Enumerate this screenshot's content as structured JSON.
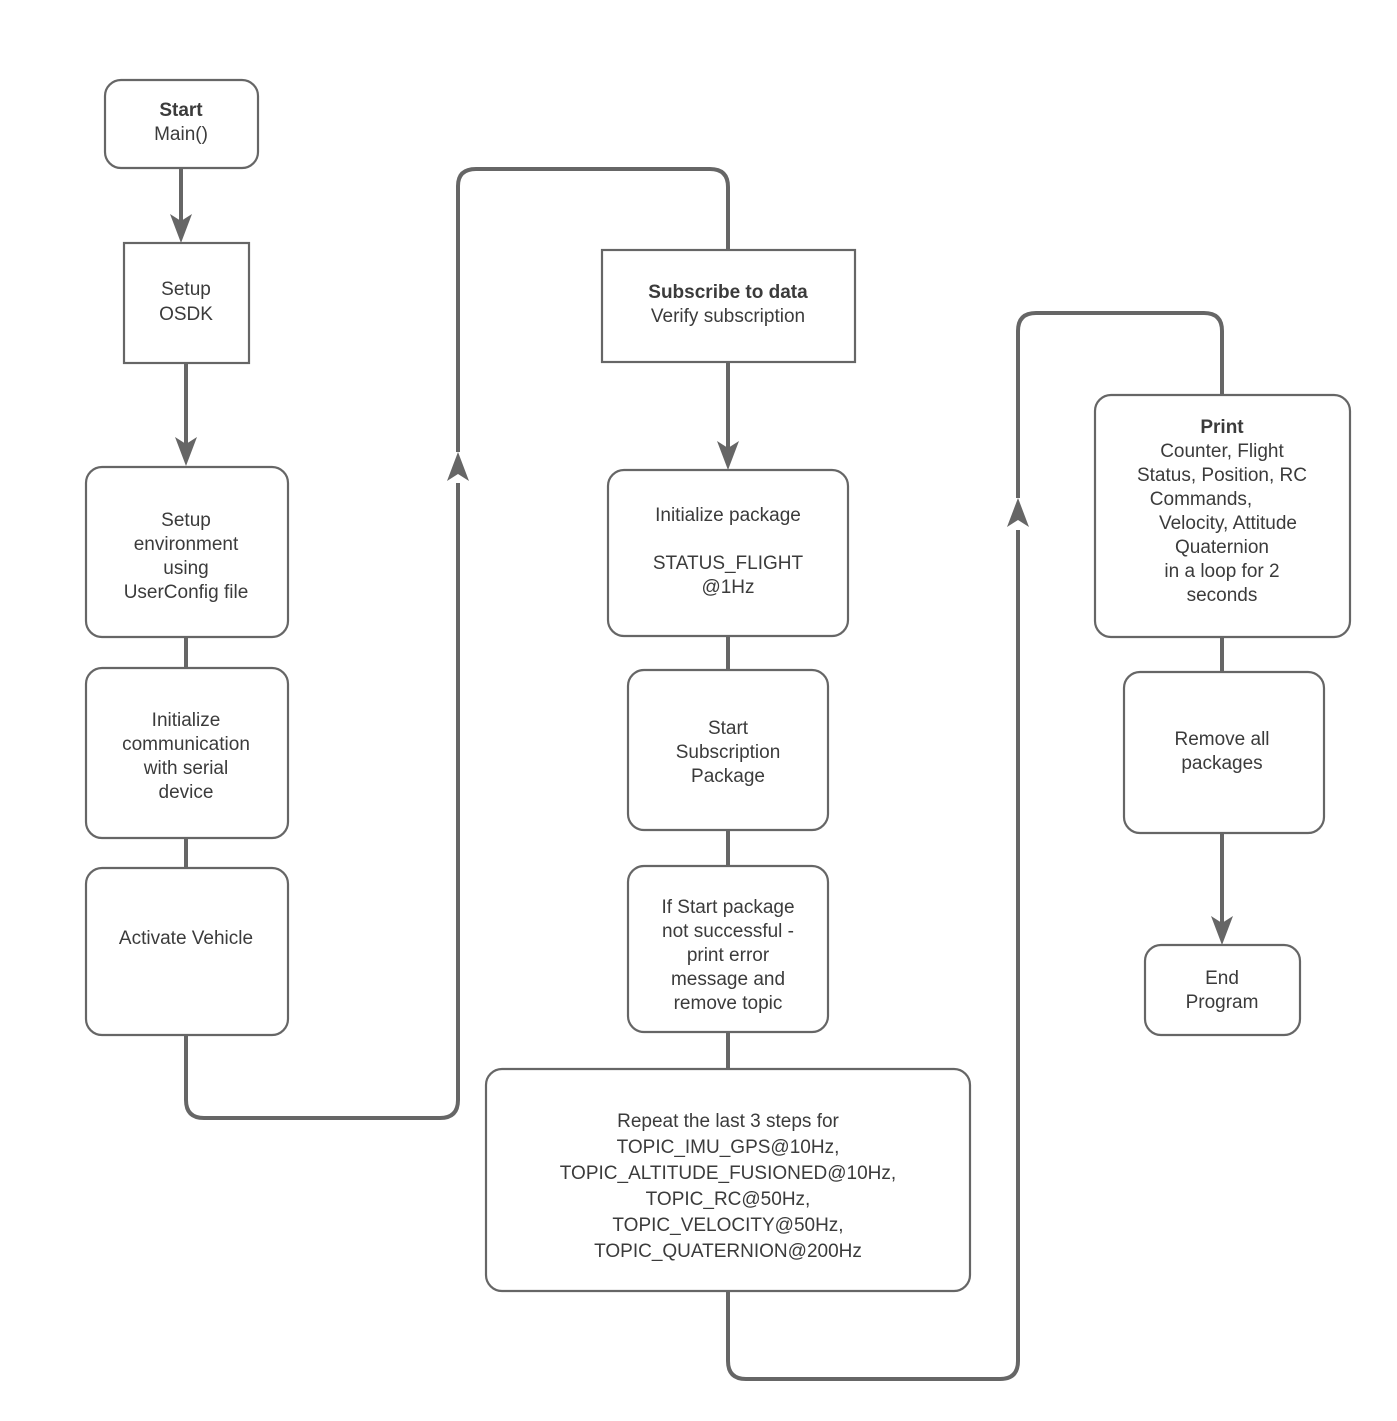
{
  "diagram": {
    "title": "OSDK Telemetry Subscription Program Flowchart",
    "colors": {
      "stroke": "#666666",
      "fill": "#ffffff",
      "text": "#3b3b3b"
    },
    "nodes": [
      {
        "id": "start",
        "shape": "rounded-rect",
        "lines": [
          {
            "text": "Start",
            "bold": true
          },
          {
            "text": "Main()",
            "bold": false
          }
        ]
      },
      {
        "id": "setup-osdk",
        "shape": "rect",
        "lines": [
          {
            "text": "Setup",
            "bold": false
          },
          {
            "text": "OSDK",
            "bold": false
          }
        ]
      },
      {
        "id": "setup-environment",
        "shape": "rounded-rect",
        "lines": [
          {
            "text": "Setup",
            "bold": false
          },
          {
            "text": "environment",
            "bold": false
          },
          {
            "text": "using",
            "bold": false
          },
          {
            "text": "UserConfig file",
            "bold": false
          }
        ]
      },
      {
        "id": "init-communication",
        "shape": "rounded-rect",
        "lines": [
          {
            "text": "Initialize",
            "bold": false
          },
          {
            "text": "communication",
            "bold": false
          },
          {
            "text": "with serial",
            "bold": false
          },
          {
            "text": "device",
            "bold": false
          }
        ]
      },
      {
        "id": "activate-vehicle",
        "shape": "rounded-rect",
        "lines": [
          {
            "text": "Activate Vehicle",
            "bold": false
          }
        ]
      },
      {
        "id": "subscribe-to-data",
        "shape": "rect",
        "lines": [
          {
            "text": "Subscribe to data",
            "bold": true
          },
          {
            "text": "Verify subscription",
            "bold": false
          }
        ]
      },
      {
        "id": "initialize-package",
        "shape": "rounded-rect",
        "lines": [
          {
            "text": "Initialize package",
            "bold": false
          },
          {
            "text": "",
            "bold": false
          },
          {
            "text": "STATUS_FLIGHT",
            "bold": false
          },
          {
            "text": "@1Hz",
            "bold": false
          }
        ]
      },
      {
        "id": "start-subscription-package",
        "shape": "rounded-rect",
        "lines": [
          {
            "text": "Start",
            "bold": false
          },
          {
            "text": "Subscription",
            "bold": false
          },
          {
            "text": "Package",
            "bold": false
          }
        ]
      },
      {
        "id": "start-package-error",
        "shape": "rounded-rect",
        "lines": [
          {
            "text": "If Start package",
            "bold": false
          },
          {
            "text": "not successful -",
            "bold": false
          },
          {
            "text": "print error",
            "bold": false
          },
          {
            "text": "message and",
            "bold": false
          },
          {
            "text": "remove topic",
            "bold": false
          }
        ]
      },
      {
        "id": "repeat-steps",
        "shape": "rounded-rect",
        "lines": [
          {
            "text": "Repeat the last 3 steps for",
            "bold": false
          },
          {
            "text": "TOPIC_IMU_GPS@10Hz,",
            "bold": false
          },
          {
            "text": "TOPIC_ALTITUDE_FUSIONED@10Hz,",
            "bold": false
          },
          {
            "text": "TOPIC_RC@50Hz,",
            "bold": false
          },
          {
            "text": "TOPIC_VELOCITY@50Hz,",
            "bold": false
          },
          {
            "text": "TOPIC_QUATERNION@200Hz",
            "bold": false
          }
        ]
      },
      {
        "id": "print",
        "shape": "rounded-rect",
        "lines": [
          {
            "text": "Print",
            "bold": true
          },
          {
            "text": "Counter, Flight",
            "bold": false
          },
          {
            "text": "Status, Position, RC",
            "bold": false
          },
          {
            "text": "Commands,",
            "bold": false
          },
          {
            "text": "Velocity, Attitude",
            "bold": false
          },
          {
            "text": "Quaternion",
            "bold": false
          },
          {
            "text": "in a loop for 2",
            "bold": false
          },
          {
            "text": "seconds",
            "bold": false
          }
        ]
      },
      {
        "id": "remove-all-packages",
        "shape": "rounded-rect",
        "lines": [
          {
            "text": "Remove all",
            "bold": false
          },
          {
            "text": "packages",
            "bold": false
          }
        ]
      },
      {
        "id": "end-program",
        "shape": "rounded-rect",
        "lines": [
          {
            "text": "End",
            "bold": false
          },
          {
            "text": "Program",
            "bold": false
          }
        ]
      }
    ]
  }
}
